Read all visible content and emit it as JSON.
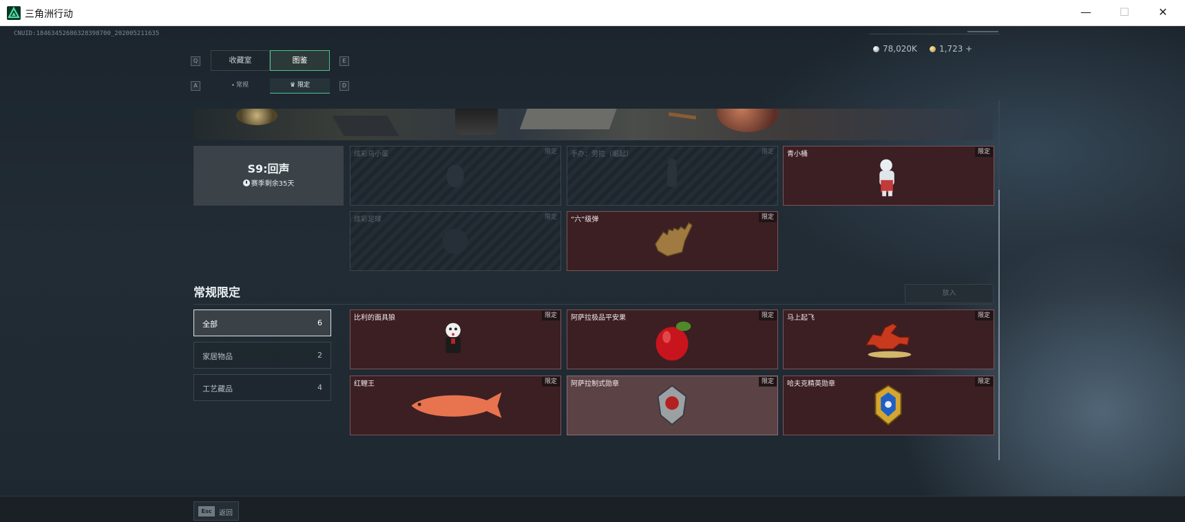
{
  "window": {
    "title": "三角洲行动",
    "minimize_glyph": "—",
    "maximize_glyph": "☐",
    "close_glyph": "✕"
  },
  "uid": "CNUID:18463452686328398700_202005211635",
  "currency": {
    "silver_value": "78,020K",
    "gold_value": "1,723 +"
  },
  "tabs": {
    "left_key": "Q",
    "right_key": "E",
    "items": [
      {
        "label": "收藏室",
        "active": false
      },
      {
        "label": "图鉴",
        "active": true
      }
    ]
  },
  "subtabs": {
    "left_key": "A",
    "right_key": "D",
    "items": [
      {
        "label": "常规",
        "icon": "drop-icon",
        "active": false
      },
      {
        "label": "限定",
        "icon": "crown-icon",
        "active": true
      }
    ]
  },
  "season": {
    "title": "S9:回声",
    "remaining": "赛季剩余35天"
  },
  "season_cards": [
    {
      "name": "炫彩乌小蛋",
      "tag": "限定",
      "locked": true
    },
    {
      "name": "手办：劳拉（崛起）",
      "tag": "限定",
      "locked": true
    },
    {
      "name": "青小桶",
      "tag": "限定",
      "locked": false
    },
    {
      "name": "炫彩足球",
      "tag": "限定",
      "locked": true
    },
    {
      "name": "“六”级弹",
      "tag": "限定",
      "locked": false
    }
  ],
  "section": {
    "title": "常规限定",
    "place_button": "放入"
  },
  "filters": [
    {
      "label": "全部",
      "count": "6",
      "active": true
    },
    {
      "label": "家居物品",
      "count": "2",
      "active": false
    },
    {
      "label": "工艺藏品",
      "count": "4",
      "active": false
    }
  ],
  "regular_cards": [
    {
      "name": "比利的面具狼",
      "tag": "限定"
    },
    {
      "name": "阿萨拉极品平安果",
      "tag": "限定"
    },
    {
      "name": "马上起飞",
      "tag": "限定"
    },
    {
      "name": "红鲤王",
      "tag": "限定"
    },
    {
      "name": "阿萨拉制式勋章",
      "tag": "限定"
    },
    {
      "name": "哈夫克精英勋章",
      "tag": "限定"
    }
  ],
  "bottom": {
    "esc_key": "Esc",
    "back_label": "返回"
  },
  "colors": {
    "accent": "#4ec28f",
    "card_bg": "#3b1f23",
    "card_border": "#7b5558",
    "locked_bg": "#1e262d"
  }
}
